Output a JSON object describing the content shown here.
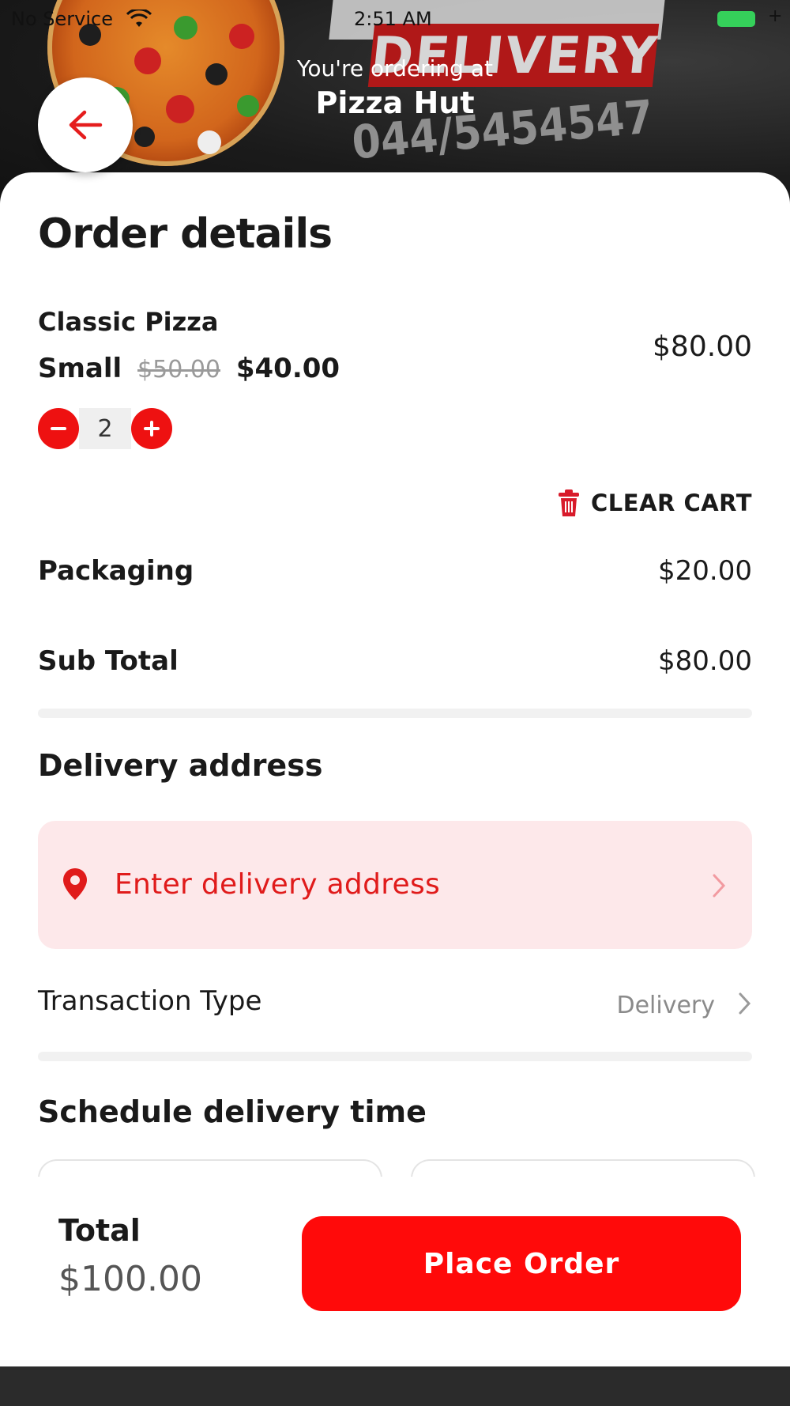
{
  "status_bar": {
    "carrier": "No Service",
    "time": "2:51 AM"
  },
  "header": {
    "ordering_at": "You're ordering at",
    "restaurant": "Pizza Hut",
    "banner_sign": "DELIVERY",
    "banner_phone": "044/5454547"
  },
  "order": {
    "title": "Order details",
    "item": {
      "name": "Classic Pizza",
      "size": "Small",
      "old_price": "$50.00",
      "price": "$40.00",
      "quantity": "2",
      "line_total": "$80.00"
    },
    "clear_cart_label": "CLEAR CART",
    "packaging": {
      "label": "Packaging",
      "value": "$20.00"
    },
    "subtotal": {
      "label": "Sub Total",
      "value": "$80.00"
    }
  },
  "delivery": {
    "title": "Delivery address",
    "address_placeholder": "Enter delivery address",
    "transaction_type_label": "Transaction Type",
    "transaction_type_value": "Delivery"
  },
  "schedule": {
    "title": "Schedule delivery time"
  },
  "footer": {
    "total_label": "Total",
    "total_value": "$100.00",
    "place_order_label": "Place Order"
  },
  "colors": {
    "accent": "#ff0a0a",
    "address_bg": "#fde8ea",
    "battery": "#35d05a"
  }
}
